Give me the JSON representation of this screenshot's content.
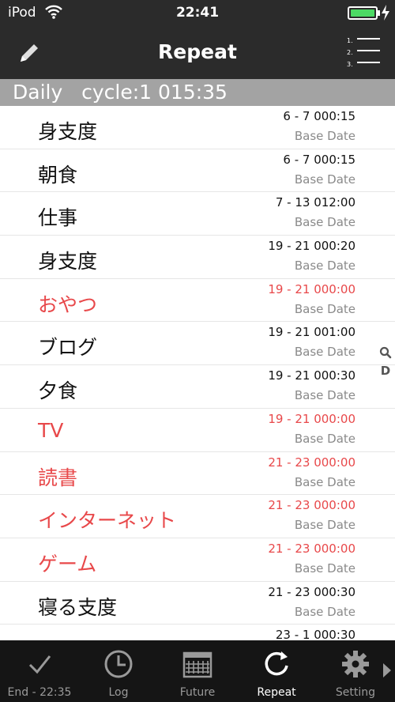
{
  "status": {
    "carrier": "iPod",
    "time": "22:41",
    "battery_level": 1.0
  },
  "nav": {
    "title": "Repeat",
    "edit_icon": "pencil-icon",
    "list_icon": "numbered-list-icon"
  },
  "section": {
    "label": "Daily   cycle:1 015:35"
  },
  "rows": [
    {
      "title": "身支度",
      "range": "6 - 7 000:15",
      "base": "Base Date",
      "alert": false
    },
    {
      "title": "朝食",
      "range": "6 - 7 000:15",
      "base": "Base Date",
      "alert": false
    },
    {
      "title": "仕事",
      "range": "7 - 13 012:00",
      "base": "Base Date",
      "alert": false
    },
    {
      "title": "身支度",
      "range": "19 - 21 000:20",
      "base": "Base Date",
      "alert": false
    },
    {
      "title": "おやつ",
      "range": "19 - 21 000:00",
      "base": "Base Date",
      "alert": true
    },
    {
      "title": "ブログ",
      "range": "19 - 21 001:00",
      "base": "Base Date",
      "alert": false
    },
    {
      "title": "夕食",
      "range": "19 - 21 000:30",
      "base": "Base Date",
      "alert": false
    },
    {
      "title": "TV",
      "range": "19 - 21 000:00",
      "base": "Base Date",
      "alert": true
    },
    {
      "title": "読書",
      "range": "21 - 23 000:00",
      "base": "Base Date",
      "alert": true
    },
    {
      "title": "インターネット",
      "range": "21 - 23 000:00",
      "base": "Base Date",
      "alert": true
    },
    {
      "title": "ゲーム",
      "range": "21 - 23 000:00",
      "base": "Base Date",
      "alert": true
    },
    {
      "title": "寝る支度",
      "range": "21 - 23 000:30",
      "base": "Base Date",
      "alert": false
    },
    {
      "title": "",
      "range": "23 - 1 000:30",
      "base": "",
      "alert": false
    }
  ],
  "index": {
    "search_icon": "search-icon",
    "letter": "D"
  },
  "tabs": [
    {
      "label": "End - 22:35",
      "icon": "checkmark-icon",
      "active": false
    },
    {
      "label": "Log",
      "icon": "clock-icon",
      "active": false
    },
    {
      "label": "Future",
      "icon": "calendar-icon",
      "active": false
    },
    {
      "label": "Repeat",
      "icon": "repeat-icon",
      "active": true
    },
    {
      "label": "Setting",
      "icon": "gear-icon",
      "active": false
    }
  ],
  "colors": {
    "bar": "#2b2b2b",
    "section": "#a3a3a3",
    "alert": "#e8484a",
    "tabbar": "#151515",
    "battery": "#4cd964"
  }
}
